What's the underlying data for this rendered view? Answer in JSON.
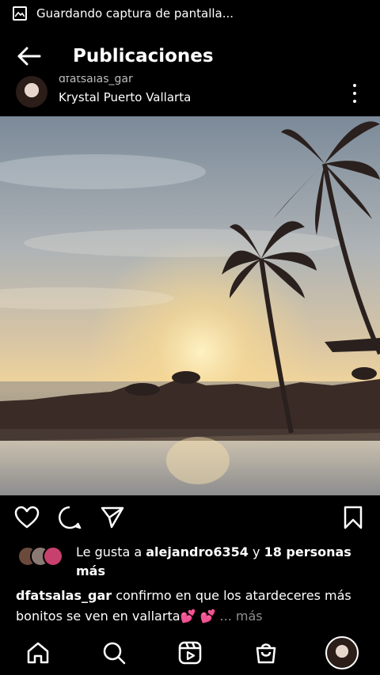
{
  "statusbar": {
    "icon": "screenshot-icon",
    "text": "Guardando captura de pantalla..."
  },
  "header": {
    "back_icon": "arrow-left-icon",
    "title": "Publicaciones"
  },
  "post": {
    "username": "dfatsalas_gar",
    "location": "Krystal Puerto Vallarta",
    "more_icon": "more-vertical-icon",
    "image_description_icon": "sunset-beach-photo"
  },
  "actions": {
    "like": "heart-icon",
    "comment": "comment-icon",
    "share": "send-icon",
    "save": "bookmark-icon"
  },
  "likes": {
    "prefix": "Le gusta a ",
    "user": "alejandro6354",
    "middle": " y ",
    "others": "18 personas más"
  },
  "caption": {
    "username": "dfatsalas_gar",
    "text": " confirmo en que los atardeceres más bonitos se ven en vallarta",
    "emoji": "💕 💕",
    "ellipsis": " ... ",
    "more": "más"
  },
  "bottomnav": {
    "home": "home-icon",
    "search": "search-icon",
    "reels": "reels-icon",
    "shop": "shop-icon",
    "profile": "profile-avatar"
  },
  "colors": {
    "background": "#000000",
    "text": "#ffffff",
    "muted": "#8e8e8e",
    "emoji": "#ff3aa6"
  }
}
